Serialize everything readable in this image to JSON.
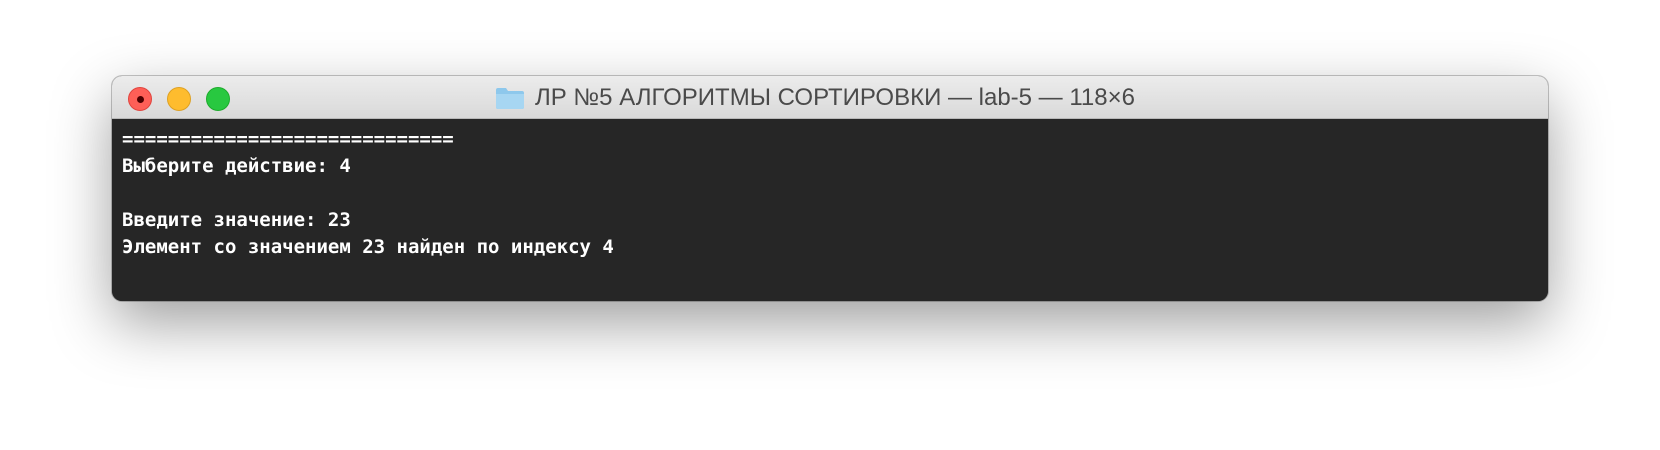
{
  "window": {
    "title": "ЛР №5 АЛГОРИТМЫ СОРТИРОВКИ — lab-5 — 118×6",
    "title_icon": "folder-icon"
  },
  "terminal": {
    "lines": [
      "=============================",
      "Выберите действие: 4",
      "",
      "Введите значение: 23",
      "Элемент со значением 23 найден по индексу 4"
    ]
  },
  "colors": {
    "terminal_bg": "#262626",
    "terminal_fg": "#ffffff",
    "close": "#fe5f57",
    "minimize": "#febc2e",
    "zoom": "#28c840"
  }
}
